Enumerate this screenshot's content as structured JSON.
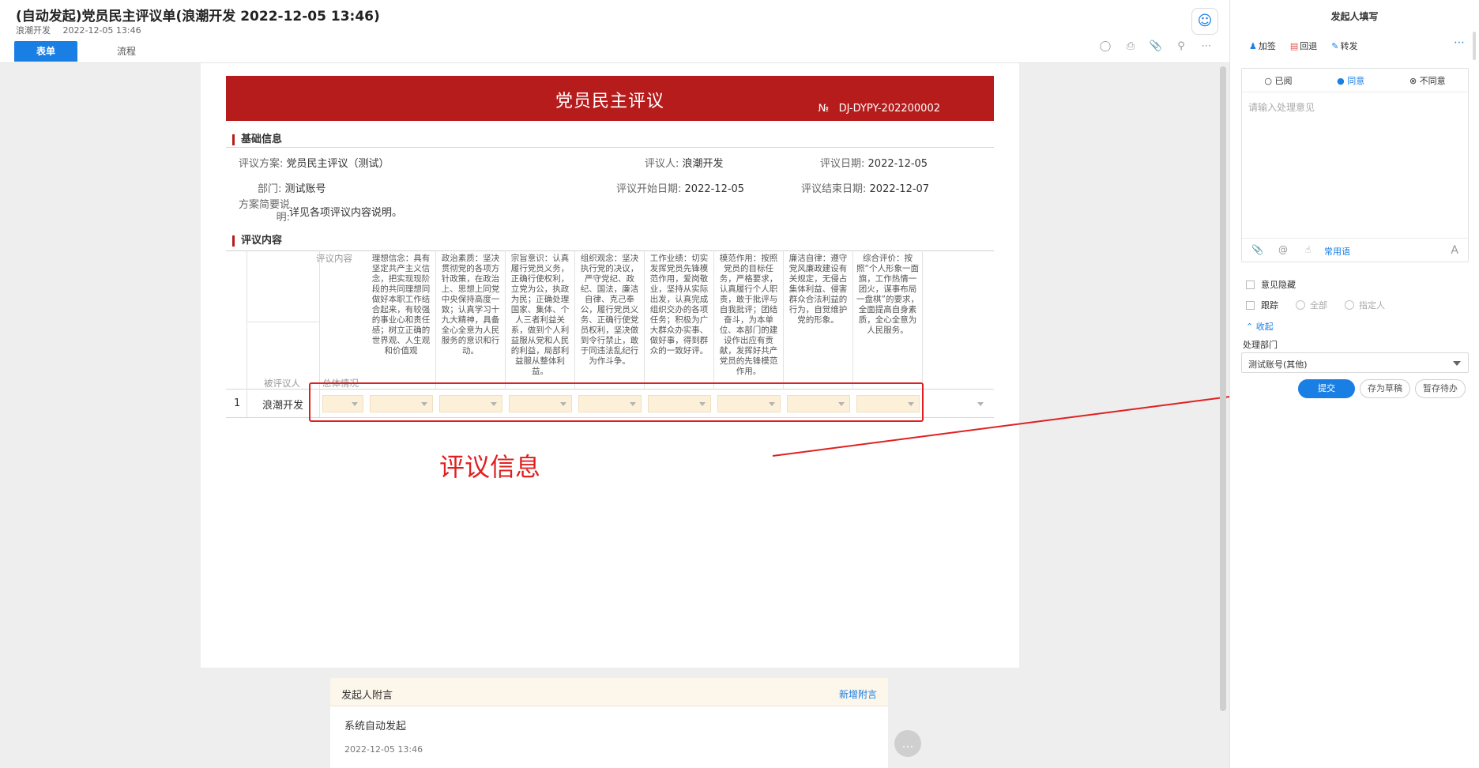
{
  "header": {
    "title": "(自动发起)党员民主评议单(浪潮开发 2022-12-05 13:46)",
    "author": "浪潮开发",
    "created": "2022-12-05 13:46",
    "tabs": [
      {
        "label": "表单",
        "active": true
      },
      {
        "label": "流程",
        "active": false
      }
    ],
    "tool_icons": [
      "comment-icon",
      "print-icon",
      "attachment-icon",
      "search-icon",
      "more-icon"
    ]
  },
  "form": {
    "banner_title": "党员民主评议",
    "banner_no_label": "№",
    "banner_no": "DJ-DYPY-202200002",
    "section_basic": "基础信息",
    "section_content": "评议内容",
    "fields": {
      "plan_label": "评议方案:",
      "plan_value": "党员民主评议（测试）",
      "reviewer_label": "评议人:",
      "reviewer_value": "浪潮开发",
      "date_label": "评议日期:",
      "date_value": "2022-12-05",
      "dept_label": "部门:",
      "dept_value": "测试账号",
      "start_label": "评议开始日期:",
      "start_value": "2022-12-05",
      "end_label": "评议结束日期:",
      "end_value": "2022-12-07",
      "desc_label_1": "方案简要说",
      "desc_label_2": "明:",
      "desc_value": "详见各项评议内容说明。"
    },
    "grid": {
      "corner_content": "评议内容",
      "corner_person": "被评议人",
      "corner_overall": "总体情况",
      "criteria": [
        "理想信念：具有坚定共产主义信念，把实现现阶段的共同理想同做好本职工作结合起来，有较强的事业心和责任感；树立正确的世界观、人生观和价值观",
        "政治素质：坚决贯彻党的各项方针政策，在政治上、思想上同党中央保持高度一致；认真学习十九大精神，具备全心全意为人民服务的意识和行动。",
        "宗旨意识：认真履行党员义务，正确行使权利，立党为公，执政为民；正确处理国家、集体、个人三者利益关系，做到个人利益服从党和人民的利益，局部利益服从整体利益。",
        "组织观念：坚决执行党的决议，严守党纪、政纪、国法，廉洁自律、克己奉公，履行党员义务、正确行使党员权利，坚决做到令行禁止，敢于同违法乱纪行为作斗争。",
        "工作业绩：切实发挥党员先锋模范作用，爱岗敬业，坚持从实际出发，认真完成组织交办的各项任务；积极为广大群众办实事、做好事，得到群众的一致好评。",
        "模范作用：按照党员的目标任务，严格要求，认真履行个人职责，敢于批评与自我批评；团结奋斗，为本单位、本部门的建设作出应有贡献，发挥好共产党员的先锋模范作用。",
        "廉洁自律：遵守党风廉政建设有关规定，无侵占集体利益、侵害群众合法利益的行为，自觉维护党的形象。",
        "综合评价：按照“个人形象一面旗，工作热情一团火，谋事布局一盘棋”的要求，全面提高自身素质，全心全意为人民服务。"
      ],
      "rows": [
        {
          "no": "1",
          "name": "浪潮开发"
        }
      ]
    },
    "annotation": "评议信息"
  },
  "remark": {
    "title": "发起人附言",
    "add_link": "新增附言",
    "text": "系统自动发起",
    "date": "2022-12-05 13:46"
  },
  "panel": {
    "title": "发起人填写",
    "actions": [
      "加签",
      "回退",
      "转发"
    ],
    "radios": [
      {
        "label": "已阅",
        "on": false
      },
      {
        "label": "同意",
        "on": true
      },
      {
        "label": "不同意",
        "on": false
      }
    ],
    "placeholder": "请输入处理意见",
    "common_phrase": "常用语",
    "hide_opinion": "意见隐藏",
    "track": "跟踪",
    "track_all": "全部",
    "track_specified": "指定人",
    "fold": "收起",
    "dept_label": "处理部门",
    "dept_value": "测试账号(其他)",
    "submit": "提交",
    "save_draft": "存为草稿",
    "hold": "暂存待办"
  },
  "colors": {
    "accent": "#1a7fe5",
    "banner": "#b71c1c",
    "highlight": "#e02020",
    "select_bg": "#fdf0d8"
  }
}
